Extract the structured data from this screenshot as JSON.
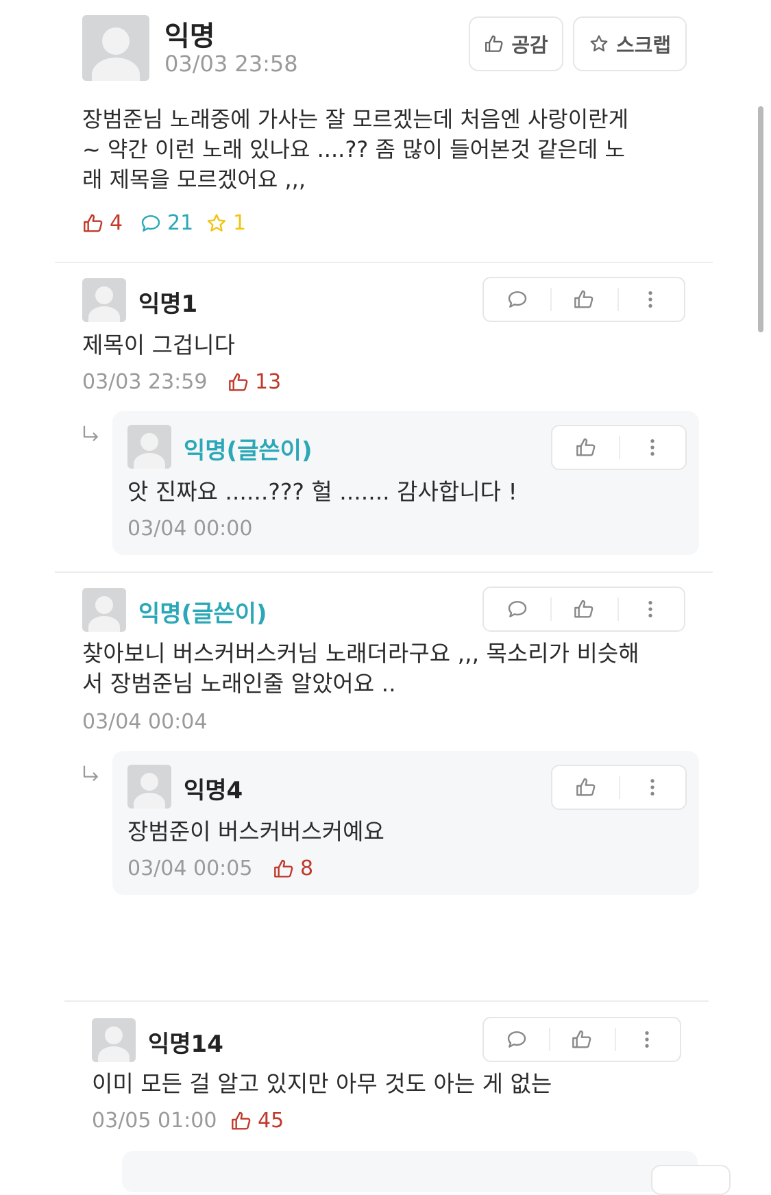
{
  "post": {
    "author": "익명",
    "time": "03/03 23:58",
    "like_button": "공감",
    "scrap_button": "스크랩",
    "body_lines": [
      "장범준님 노래중에 가사는 잘 모르겠는데 처음엔 사랑이란게",
      "~ 약간 이런 노래 있나요 ....?? 좀 많이 들어본것 같은데 노",
      "래 제목을 모르겠어요 ,,,"
    ],
    "likes": "4",
    "comments": "21",
    "scraps": "1"
  },
  "comments": [
    {
      "author": "익명1",
      "text": "제목이 그겁니다",
      "time": "03/03 23:59",
      "likes": "13"
    },
    {
      "author": "익명(글쓴이)",
      "text": "앗 진짜요 ......??? 헐 ....... 감사합니다 !",
      "time": "03/04 00:00"
    },
    {
      "author": "익명(글쓴이)",
      "text_lines": [
        "찾아보니 버스커버스커님 노래더라구요 ,,, 목소리가 비슷해",
        "서 장범준님 노래인줄 알았어요 .."
      ],
      "time": "03/04 00:04"
    },
    {
      "author": "익명4",
      "text": "장범준이 버스커버스커예요",
      "time": "03/04 00:05",
      "likes": "8"
    },
    {
      "author": "익명14",
      "text": "이미 모든 걸 알고 있지만 아무 것도 아는 게 없는",
      "time": "03/05 01:00",
      "likes": "45"
    }
  ],
  "colors": {
    "like": "#c0392b",
    "comment": "#2aa8b8",
    "scrap": "#f1c40f",
    "op_name": "#2aa8b8"
  },
  "icons": [
    "thumbs-up-icon",
    "star-icon",
    "comment-icon",
    "more-icon",
    "reply-arrow-icon"
  ]
}
